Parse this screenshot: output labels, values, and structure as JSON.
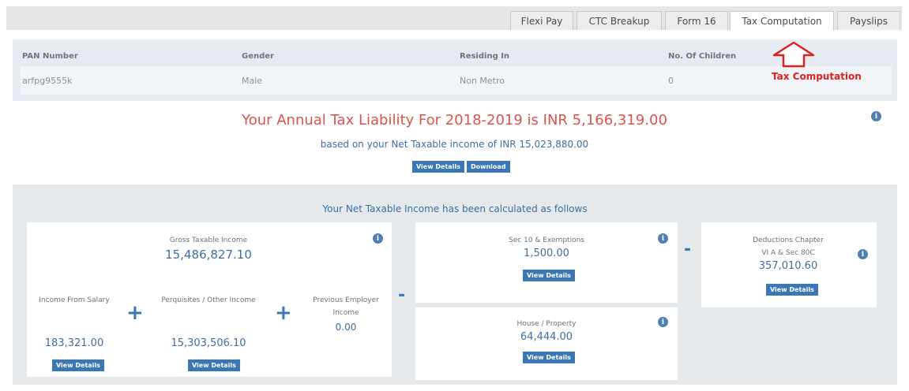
{
  "tabs": [
    {
      "label": "Flexi Pay",
      "active": false
    },
    {
      "label": "CTC Breakup",
      "active": false
    },
    {
      "label": "Form 16",
      "active": false
    },
    {
      "label": "Tax Computation",
      "active": true
    },
    {
      "label": "Payslips",
      "active": false
    }
  ],
  "info": {
    "headers": {
      "pan": "PAN Number",
      "gender": "Gender",
      "residing": "Residing In",
      "children": "No. Of Children"
    },
    "values": {
      "pan": "arfpg9555k",
      "gender": "Male",
      "residing": "Non Metro",
      "children": "0"
    }
  },
  "annotation": {
    "text": "Tax Computation",
    "color": "#e02020"
  },
  "summary": {
    "liability": "Your Annual Tax Liability For 2018-2019 is INR 5,166,319.00",
    "based_on": "based on your Net Taxable income of INR 15,023,880.00",
    "view_details": "View Details",
    "download": "Download"
  },
  "calc": {
    "title": "Your Net Taxable Income has been calculated as follows",
    "gross": {
      "label": "Gross Taxable Income",
      "value": "15,486,827.10"
    },
    "salary": {
      "label": "Income From Salary",
      "value": "183,321.00",
      "button": "View Details"
    },
    "perquisites": {
      "label": "Perquisites / Other Income",
      "value": "15,303,506.10",
      "button": "View Details"
    },
    "prev_employer": {
      "label_line1": "Previous Employer",
      "label_line2": "Income",
      "value": "0.00"
    },
    "sec10": {
      "label": "Sec 10 & Exemptions",
      "value": "1,500.00",
      "button": "View Details"
    },
    "house": {
      "label": "House / Property",
      "value": "64,444.00",
      "button": "View Details"
    },
    "deductions": {
      "label_line1": "Deductions Chapter",
      "label_line2": "VI A & Sec 80C",
      "value": "357,010.60",
      "button": "View Details"
    },
    "plus": "+",
    "minus": "-"
  },
  "colors": {
    "accent": "#3b76b5",
    "liability": "#d9534f",
    "panel": "#e6e9ec"
  },
  "icons": {
    "info": "info-icon"
  }
}
